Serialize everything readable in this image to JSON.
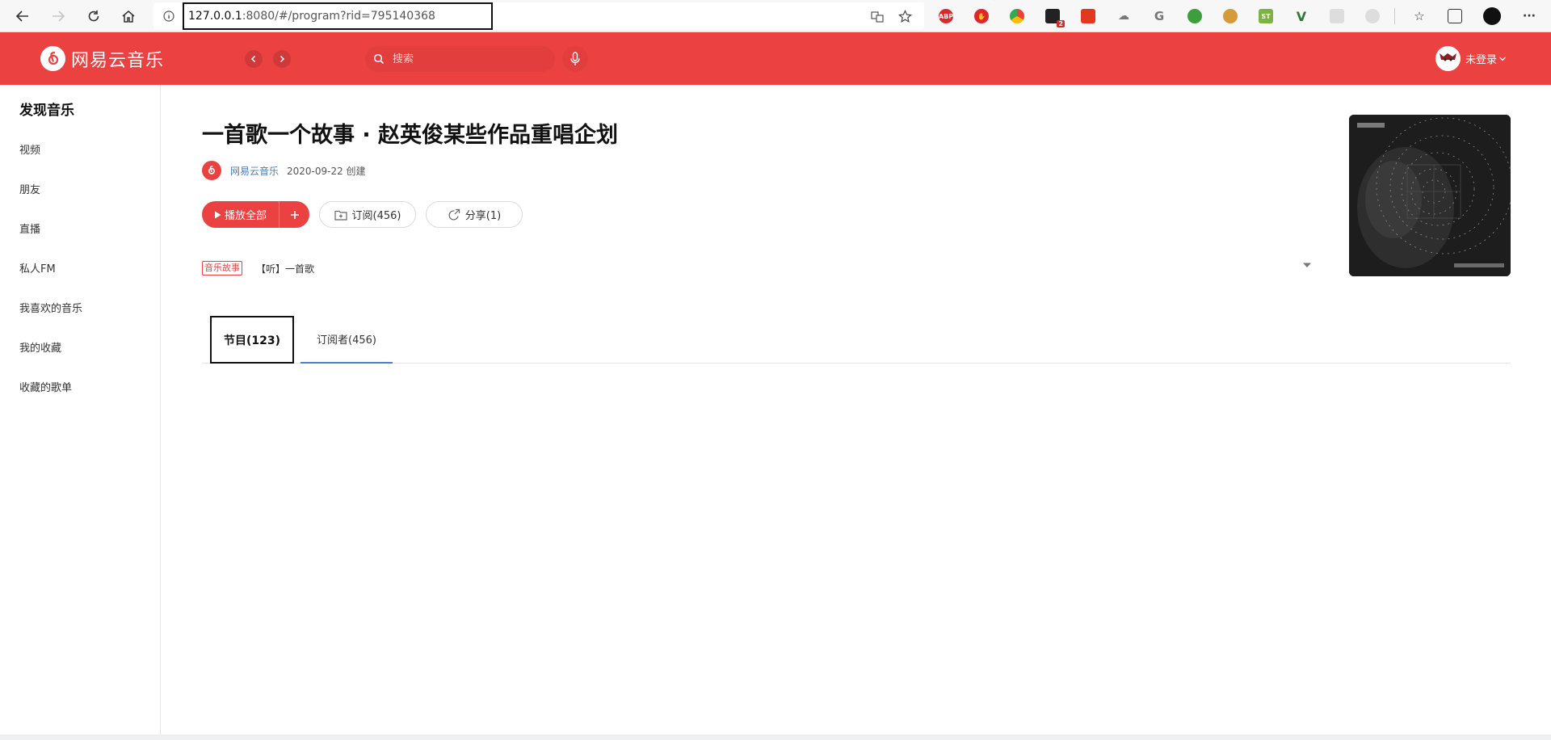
{
  "browser": {
    "url_host": "127.0.0.1",
    "url_rest": ":8080/#/program?rid=795140368"
  },
  "app": {
    "logo_text": "网易云音乐",
    "search_placeholder": "搜索",
    "login_label": "未登录"
  },
  "sidebar": {
    "title": "发现音乐",
    "items": [
      {
        "label": "视频"
      },
      {
        "label": "朋友"
      },
      {
        "label": "直播"
      },
      {
        "label": "私人FM"
      },
      {
        "label": "我喜欢的音乐"
      },
      {
        "label": "我的收藏"
      },
      {
        "label": "收藏的歌单"
      }
    ]
  },
  "program": {
    "title": "一首歌一个故事 · 赵英俊某些作品重唱企划",
    "creator": "网易云音乐",
    "created": "2020-09-22 创建",
    "play_all": "播放全部",
    "subscribe": "订阅(456)",
    "share": "分享(1)",
    "tag": "音乐故事",
    "description": "【听】一首歌"
  },
  "tabs": [
    {
      "label": "节目(123)"
    },
    {
      "label": "订阅者(456)"
    }
  ],
  "colors": {
    "brand_red": "#ec4141",
    "link_blue": "#507daf",
    "tab_underline": "#4a7fd4"
  }
}
